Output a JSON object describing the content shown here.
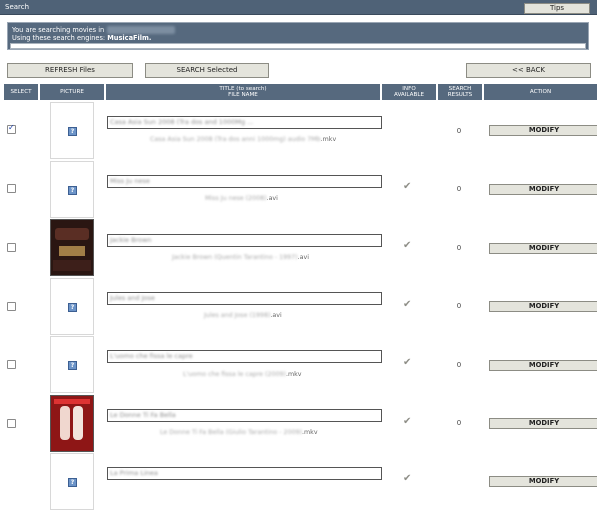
{
  "window": {
    "title": "Search",
    "tips_label": "Tips"
  },
  "info": {
    "line1_prefix": "You are searching movies in",
    "line2_prefix": "Using these search engines:",
    "engines": "MusicaFilm."
  },
  "toolbar": {
    "refresh_label": "REFRESH Files",
    "search_selected_label": "SEARCH Selected",
    "back_label": "<< BACK"
  },
  "columns": {
    "select": "SELECT",
    "picture": "PICTURE",
    "title_line1": "TITLE (to search)",
    "title_line2": "FILE NAME",
    "info_line1": "INFO",
    "info_line2": "AVAILABLE",
    "results_line1": "SEARCH",
    "results_line2": "RESULTS",
    "action": "ACTION"
  },
  "rows": [
    {
      "checked": true,
      "picture": "placeholder",
      "title": "Casa Asia Sun 2008 (Tra dos and 1000Mg ...",
      "file_name_blurred": "Casa Asia Sun 2008 (Tra dos anni 1000mg) audio 7Mb",
      "ext": ".mkv",
      "info_available": false,
      "results": "0",
      "action": "MODIFY"
    },
    {
      "checked": false,
      "picture": "placeholder",
      "title": "Miss Ju nese",
      "file_name_blurred": "Miss Ju nese (2008)",
      "ext": ".avi",
      "info_available": true,
      "results": "0",
      "action": "MODIFY"
    },
    {
      "checked": false,
      "picture": "poster",
      "title": "Jackie Brown",
      "file_name_blurred": "Jackie Brown (Quentin Tarantino - 1997)",
      "ext": ".avi",
      "info_available": true,
      "results": "0",
      "action": "MODIFY"
    },
    {
      "checked": false,
      "picture": "placeholder",
      "title": "Jules and Jose",
      "file_name_blurred": "Jules and Jose (1998)",
      "ext": ".avi",
      "info_available": true,
      "results": "0",
      "action": "MODIFY"
    },
    {
      "checked": false,
      "picture": "placeholder",
      "title": "L'uomo che fissa le capre",
      "file_name_blurred": "L'uomo che fissa le capre (2009)",
      "ext": ".mkv",
      "info_available": true,
      "results": "0",
      "action": "MODIFY"
    },
    {
      "checked": false,
      "picture": "poster-red",
      "title": "Le Donne Ti Fa Bella",
      "file_name_blurred": "Le Donne Ti Fa Bella (Giulio Tarantino - 2009)",
      "ext": ".mkv",
      "info_available": true,
      "results": "0",
      "action": "MODIFY"
    },
    {
      "checked": false,
      "picture": "placeholder",
      "title": "La Prima Linea",
      "file_name_blurred": "",
      "ext": "",
      "info_available": true,
      "results": "0",
      "action": "MODIFY"
    }
  ],
  "colors": {
    "header_bg": "#56697e",
    "titlebar_bg": "#4f6277",
    "button_bg": "#e4e4dc"
  }
}
